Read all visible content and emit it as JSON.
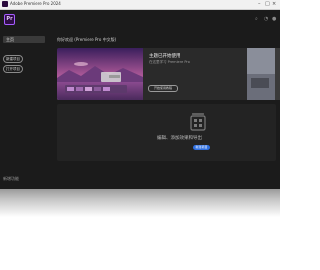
{
  "window": {
    "title": "Adobe Premiere Pro 2024"
  },
  "app": {
    "logo_text": "Pr"
  },
  "sidebar": {
    "home_label": "主页",
    "new_project_label": "新建项目",
    "open_project_label": "打开项目",
    "footer_label": "新增功能"
  },
  "main": {
    "section_title": "你好欢迎 (Premiere Pro 中文版)",
    "hero": {
      "title": "主题已开始使用",
      "subtitle": "在这里学习 Premiere Pro",
      "button_label": "开始使用教程"
    },
    "empty": {
      "message": "编辑、添加效果和导出",
      "button_label": "新建项目"
    }
  },
  "colors": {
    "accent": "#2f6fe0",
    "brand": "#a65cff",
    "background": "#1b1b1b"
  }
}
